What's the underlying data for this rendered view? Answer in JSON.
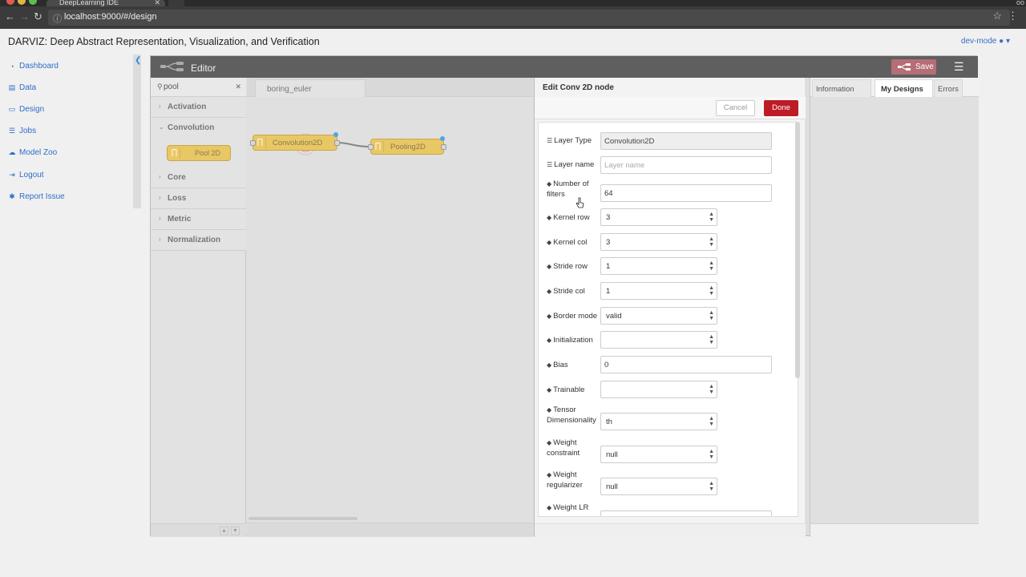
{
  "browser": {
    "tab_title": "DeepLearning IDE",
    "url": "localhost:9000/#/design",
    "top_right_text": "oo"
  },
  "app": {
    "title": "DARVIZ: Deep Abstract Representation, Visualization, and Verification",
    "user": "dev-mode"
  },
  "nav": {
    "items": [
      {
        "label": "Dashboard",
        "icon": "dashboard-icon"
      },
      {
        "label": "Data",
        "icon": "database-icon"
      },
      {
        "label": "Design",
        "icon": "edit-icon"
      },
      {
        "label": "Jobs",
        "icon": "list-icon"
      },
      {
        "label": "Model Zoo",
        "icon": "cloud-icon"
      },
      {
        "label": "Logout",
        "icon": "logout-icon"
      },
      {
        "label": "Report Issue",
        "icon": "bug-icon"
      }
    ]
  },
  "editor": {
    "label": "Editor",
    "save_label": "Save"
  },
  "palette": {
    "search_value": "pool",
    "categories": [
      "Activation",
      "Convolution",
      "Core",
      "Loss",
      "Metric",
      "Normalization"
    ],
    "node_label": "Pool 2D"
  },
  "workspace": {
    "tab_label": "boring_euler",
    "nodes": [
      {
        "label": "Convolution2D"
      },
      {
        "label": "Pooling2D"
      }
    ]
  },
  "edit_panel": {
    "title": "Edit Conv 2D node",
    "cancel_label": "Cancel",
    "done_label": "Done",
    "fields": {
      "layer_type": {
        "label": "Layer Type",
        "value": "Convolution2D"
      },
      "layer_name": {
        "label": "Layer name",
        "placeholder": "Layer name"
      },
      "num_filters": {
        "label": "Number of filters",
        "value": "64"
      },
      "kernel_row": {
        "label": "Kernel row",
        "value": "3"
      },
      "kernel_col": {
        "label": "Kernel col",
        "value": "3"
      },
      "stride_row": {
        "label": "Stride row",
        "value": "1"
      },
      "stride_col": {
        "label": "Stride col",
        "value": "1"
      },
      "border_mode": {
        "label": "Border mode",
        "value": "valid"
      },
      "initialization": {
        "label": "Initialization",
        "value": ""
      },
      "bias": {
        "label": "Bias",
        "value": "0"
      },
      "trainable": {
        "label": "Trainable",
        "value": ""
      },
      "tensor_dim": {
        "label": "Tensor Dimensionality",
        "value": "th"
      },
      "weight_constraint": {
        "label": "Weight constraint",
        "value": "null"
      },
      "weight_regularizer": {
        "label": "Weight regularizer",
        "value": "null"
      },
      "weight_lr": {
        "label": "Weight LR"
      }
    }
  },
  "sidebar": {
    "tabs": [
      "Information",
      "My Designs",
      "Errors"
    ],
    "active_tab": "My Designs"
  },
  "colors": {
    "node_fill": "#e8c765",
    "done_button": "#bd1c26",
    "save_button": "#b56e76",
    "link_blue": "#2d6ec8"
  }
}
